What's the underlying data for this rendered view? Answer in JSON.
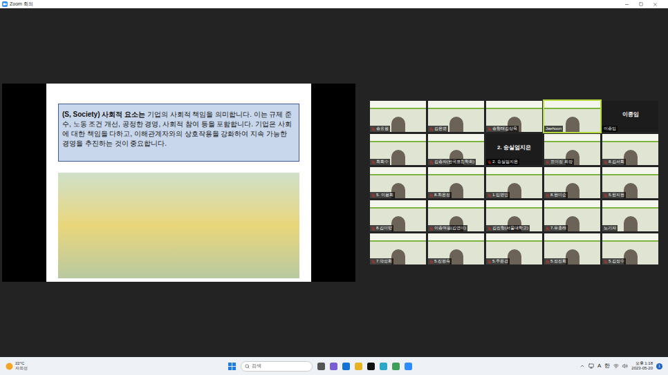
{
  "window": {
    "title": "Zoom 회의"
  },
  "share": {
    "slide": {
      "heading_bold": "(S, Society) 사회적 요소는",
      "body": " 기업의 사회적 책임을 의미합니다. 이는 규제 준수, 노동 조건 개선, 공정한 경영, 사회적 참여 등을 포함합니다. 기업은 사회에 대한 책임을 다하고, 이해관계자와의 상호작용을 강화하여 지속 가능한 경영을 추진하는 것이 중요합니다."
    }
  },
  "participants": [
    {
      "name": "송효원",
      "video": true,
      "muted": true,
      "speaking": false
    },
    {
      "name": "김은영",
      "video": true,
      "muted": true,
      "speaking": false
    },
    {
      "name": "송형태김상욱",
      "video": true,
      "muted": true,
      "speaking": false
    },
    {
      "name": "Jaehoon",
      "video": true,
      "muted": false,
      "speaking": true
    },
    {
      "name": "이종임",
      "video": false,
      "muted": false,
      "speaking": false
    },
    {
      "name": "최희수",
      "video": true,
      "muted": true,
      "speaking": false
    },
    {
      "name": "김종자(한국코칭학회)",
      "video": true,
      "muted": true,
      "speaking": false
    },
    {
      "name": "2. 숭실엄지은",
      "video": false,
      "muted": true,
      "speaking": false
    },
    {
      "name": "표미정 회장",
      "video": true,
      "muted": true,
      "speaking": false
    },
    {
      "name": "8.김서희",
      "video": true,
      "muted": true,
      "speaking": false
    },
    {
      "name": "5. 이윤희",
      "video": true,
      "muted": true,
      "speaking": false
    },
    {
      "name": "8.최은정",
      "video": true,
      "muted": true,
      "speaking": false
    },
    {
      "name": "1.임영민",
      "video": true,
      "muted": true,
      "speaking": false
    },
    {
      "name": "8.현미순",
      "video": true,
      "muted": true,
      "speaking": false
    },
    {
      "name": "5.한지현",
      "video": true,
      "muted": true,
      "speaking": false
    },
    {
      "name": "8.김미양",
      "video": true,
      "muted": true,
      "speaking": false
    },
    {
      "name": "이종여원(김연미)",
      "video": true,
      "muted": true,
      "speaking": false
    },
    {
      "name": "김진형(서울대학교)",
      "video": true,
      "muted": true,
      "speaking": false
    },
    {
      "name": "7.유홍래",
      "video": true,
      "muted": true,
      "speaking": false
    },
    {
      "name": "노기자",
      "video": true,
      "muted": false,
      "speaking": false
    },
    {
      "name": "7.박성희",
      "video": true,
      "muted": true,
      "speaking": false
    },
    {
      "name": "5.진현숙",
      "video": true,
      "muted": true,
      "speaking": false
    },
    {
      "name": "5.주은경",
      "video": true,
      "muted": true,
      "speaking": false
    },
    {
      "name": "5.정진희",
      "video": true,
      "muted": true,
      "speaking": false
    },
    {
      "name": "5.김정수",
      "video": true,
      "muted": true,
      "speaking": false
    }
  ],
  "taskbar": {
    "weather": {
      "temp": "22°C",
      "label": "자외선"
    },
    "search": {
      "placeholder": "검색"
    },
    "tray": {
      "ime": [
        "A",
        "한"
      ],
      "time": "오후 1:18",
      "date": "2023-05-20",
      "notifications": "1"
    }
  }
}
